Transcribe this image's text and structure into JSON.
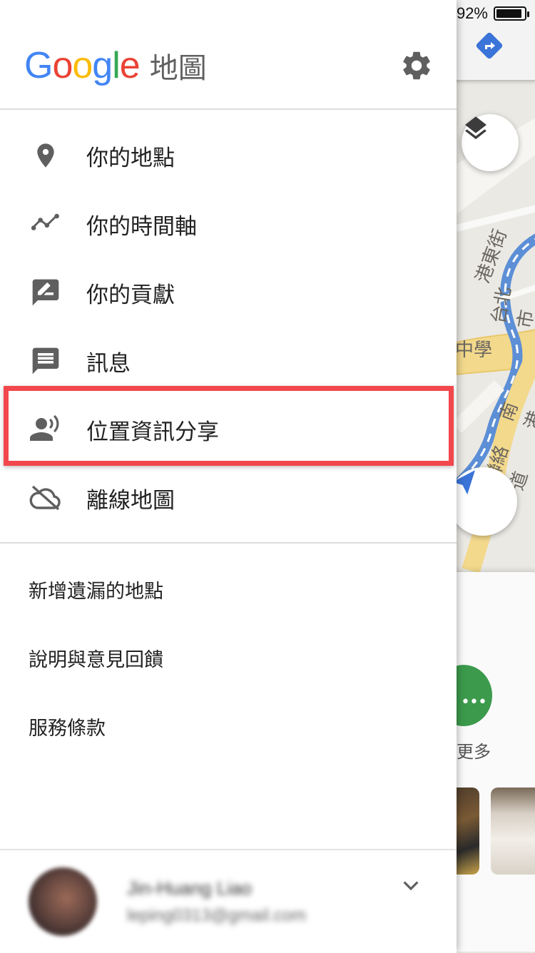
{
  "status_bar": {
    "battery_percent": "92%",
    "battery_level": 0.92
  },
  "header": {
    "logo_text": "Google",
    "logo_letter_colors": [
      "#4285F4",
      "#EA4335",
      "#FBBC05",
      "#4285F4",
      "#34A853",
      "#EA4335"
    ],
    "app_name": "地圖",
    "settings_icon": "gear-icon"
  },
  "menu": {
    "items": [
      {
        "label": "你的地點",
        "icon": "place-pin-icon"
      },
      {
        "label": "你的時間軸",
        "icon": "timeline-icon"
      },
      {
        "label": "你的貢獻",
        "icon": "rate-review-icon"
      },
      {
        "label": "訊息",
        "icon": "message-icon"
      },
      {
        "label": "位置資訊分享",
        "icon": "location-sharing-icon",
        "highlighted": true
      },
      {
        "label": "離線地圖",
        "icon": "cloud-off-icon"
      }
    ]
  },
  "links": [
    {
      "label": "新增遺漏的地點"
    },
    {
      "label": "說明與意見回饋"
    },
    {
      "label": "服務條款"
    }
  ],
  "account": {
    "name": "Jin-Huang Liao",
    "email": "leping0313@gmail.com",
    "expand_icon": "chevron-down-icon"
  },
  "map": {
    "labels": [
      "港東街",
      "台北市",
      "中學",
      "南港",
      "聯絡道",
      "南港"
    ],
    "more_label": "更多",
    "highlight_color": "#f2474c"
  }
}
